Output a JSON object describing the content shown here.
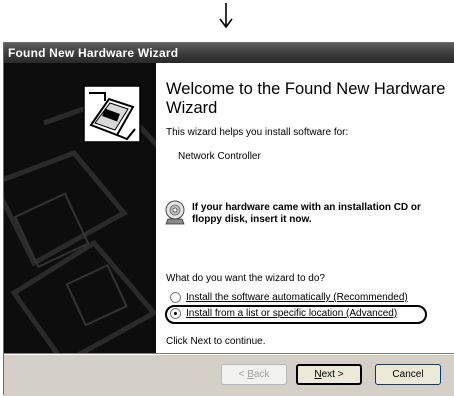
{
  "window": {
    "title": "Found New Hardware Wizard"
  },
  "content": {
    "heading": "Welcome to the Found New Hardware Wizard",
    "intro": "This wizard helps you install software for:",
    "device": "Network Controller",
    "cd_prompt": "If your hardware came with an installation CD or floppy disk, insert it now.",
    "question": "What do you want the wizard to do?",
    "options": [
      {
        "label": "Install the software automatically (Recommended)",
        "selected": false
      },
      {
        "label": "Install from a list or specific location (Advanced)",
        "selected": true
      }
    ],
    "footer": "Click Next to continue."
  },
  "buttons": {
    "back_prefix": "< ",
    "back_mnemonic": "B",
    "back_rest": "ack",
    "next_mnemonic": "N",
    "next_rest": "ext >",
    "cancel": "Cancel"
  },
  "icons": {
    "arrow": "down-arrow-icon",
    "wizard": "hardware-wizard-icon",
    "cd": "cd-disk-icon"
  }
}
